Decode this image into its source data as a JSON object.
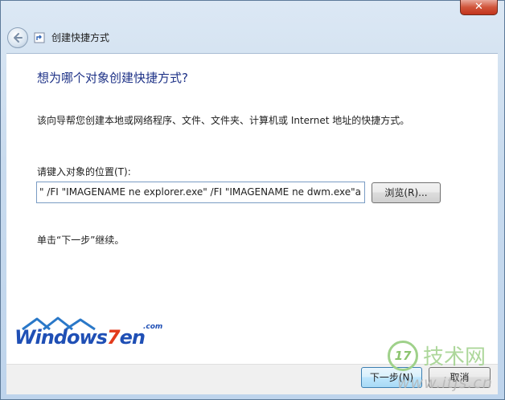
{
  "window": {
    "close_glyph": "✕",
    "title": "创建快捷方式"
  },
  "main": {
    "heading": "想为哪个对象创建快捷方式?",
    "description": "该向导帮您创建本地或网络程序、文件、文件夹、计算机或 Internet 地址的快捷方式。",
    "location_label": "请键入对象的位置(T):",
    "location_value": "\" /FI \"IMAGENAME ne explorer.exe\" /FI \"IMAGENAME ne dwm.exe\"a",
    "browse_label": "浏览(R)...",
    "hint": "单击“下一步”继续。"
  },
  "footer": {
    "next_label": "下一步(N)",
    "cancel_label": "取消"
  },
  "watermarks": {
    "windows7en_text_a": "Windows",
    "windows7en_text_b": "7",
    "windows7en_text_c": "en",
    "windows7en_dotcom": ".com",
    "itjs_badge": "17",
    "itjs_cn": "技术网",
    "itjs_url": "www.itjs.cn"
  },
  "colors": {
    "heading": "#1e3287",
    "accent_frame": "#bed4ec",
    "close_button": "#c2341c"
  },
  "icons": {
    "back": "back-arrow-icon",
    "wizard": "shortcut-wizard-icon",
    "close": "close-icon"
  }
}
